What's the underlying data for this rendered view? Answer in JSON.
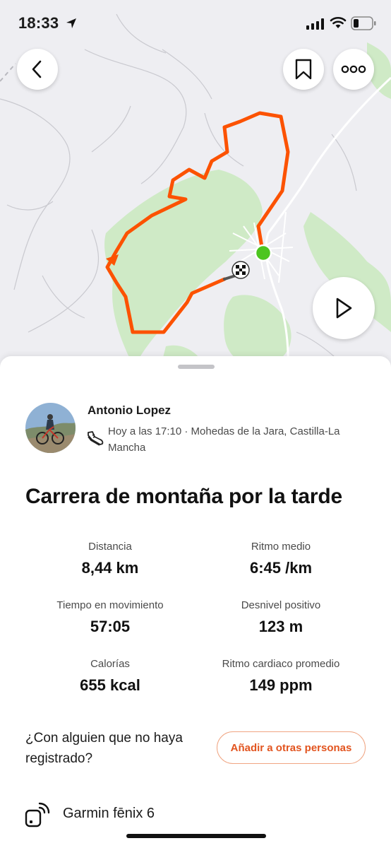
{
  "status_bar": {
    "time": "18:33"
  },
  "icons": {
    "back": "chevron-left-icon",
    "bookmark": "bookmark-icon",
    "more": "more-dots-icon",
    "play": "play-icon",
    "location": "location-arrow-icon",
    "sport": "running-shoe-icon",
    "device": "watch-icon"
  },
  "colors": {
    "route": "#fc5200",
    "start_marker": "#4cc51f",
    "accent": "#e2541f",
    "map_green": "#cfeac6",
    "map_background": "#eeeef2"
  },
  "athlete": {
    "name": "Antonio Lopez",
    "meta": "Hoy a las 17:10 · Mohedas de la Jara, Castilla-La Mancha"
  },
  "activity": {
    "title": "Carrera de montaña por la tarde"
  },
  "stats": [
    {
      "label": "Distancia",
      "value": "8,44 km"
    },
    {
      "label": "Ritmo medio",
      "value": "6:45 /km"
    },
    {
      "label": "Tiempo en movimiento",
      "value": "57:05"
    },
    {
      "label": "Desnivel positivo",
      "value": "123 m"
    },
    {
      "label": "Calorías",
      "value": "655 kcal"
    },
    {
      "label": "Ritmo cardiaco promedio",
      "value": "149 ppm"
    }
  ],
  "others": {
    "question": "¿Con alguien que no haya registrado?",
    "button_label": "Añadir a otras personas"
  },
  "device": {
    "name": "Garmin fēnix 6"
  }
}
